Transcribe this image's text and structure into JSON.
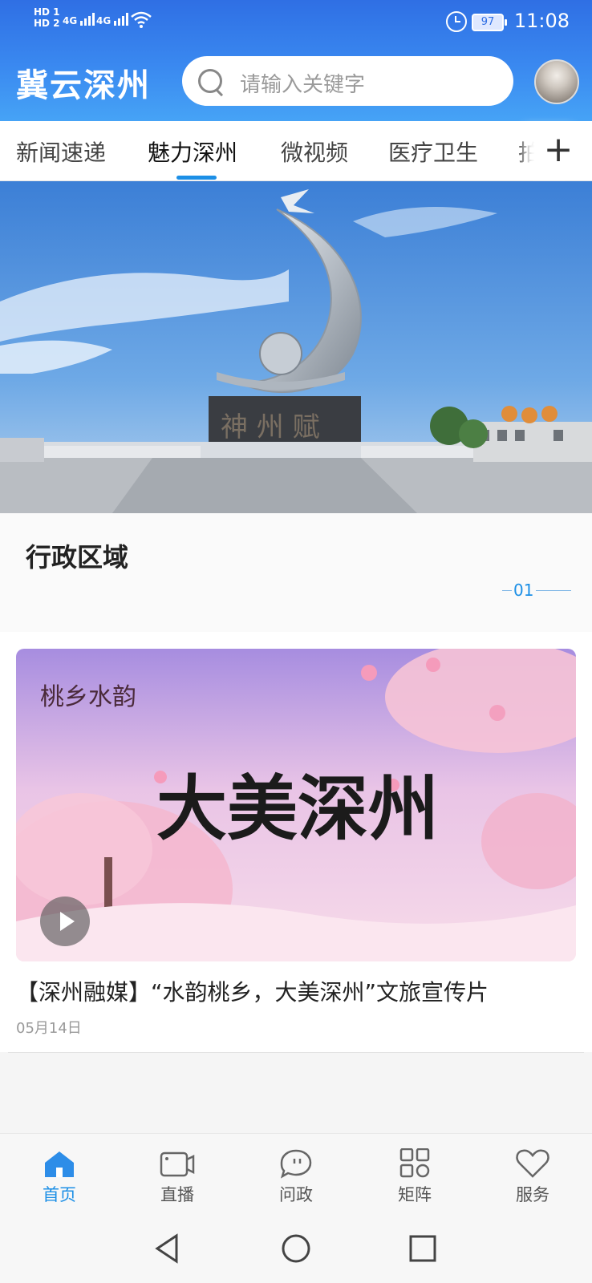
{
  "status_bar": {
    "hd1": "HD 1",
    "hd2": "HD 2",
    "net1": "4G",
    "net2": "4G",
    "battery": "97",
    "time": "11:08"
  },
  "header": {
    "app_title": "冀云深州",
    "search_placeholder": "请输入关键字"
  },
  "tabs": {
    "items": [
      "新闻速递",
      "魅力深州",
      "微视频",
      "医疗卫生",
      "拍"
    ],
    "active_index": 1
  },
  "section": {
    "title": "行政区域",
    "pager": "01"
  },
  "article": {
    "title": "【深州融媒】“水韵桃乡，大美深州”文旅宣传片",
    "date": "05月14日",
    "thumb_text_main": "大美深州",
    "thumb_text_logo": "桃乡水韵"
  },
  "bottom_nav": [
    "首页",
    "直播",
    "问政",
    "矩阵",
    "服务"
  ],
  "colors": {
    "accent": "#1c8fe6",
    "header_top": "#2f6fe4",
    "header_bottom": "#46a3f6"
  }
}
